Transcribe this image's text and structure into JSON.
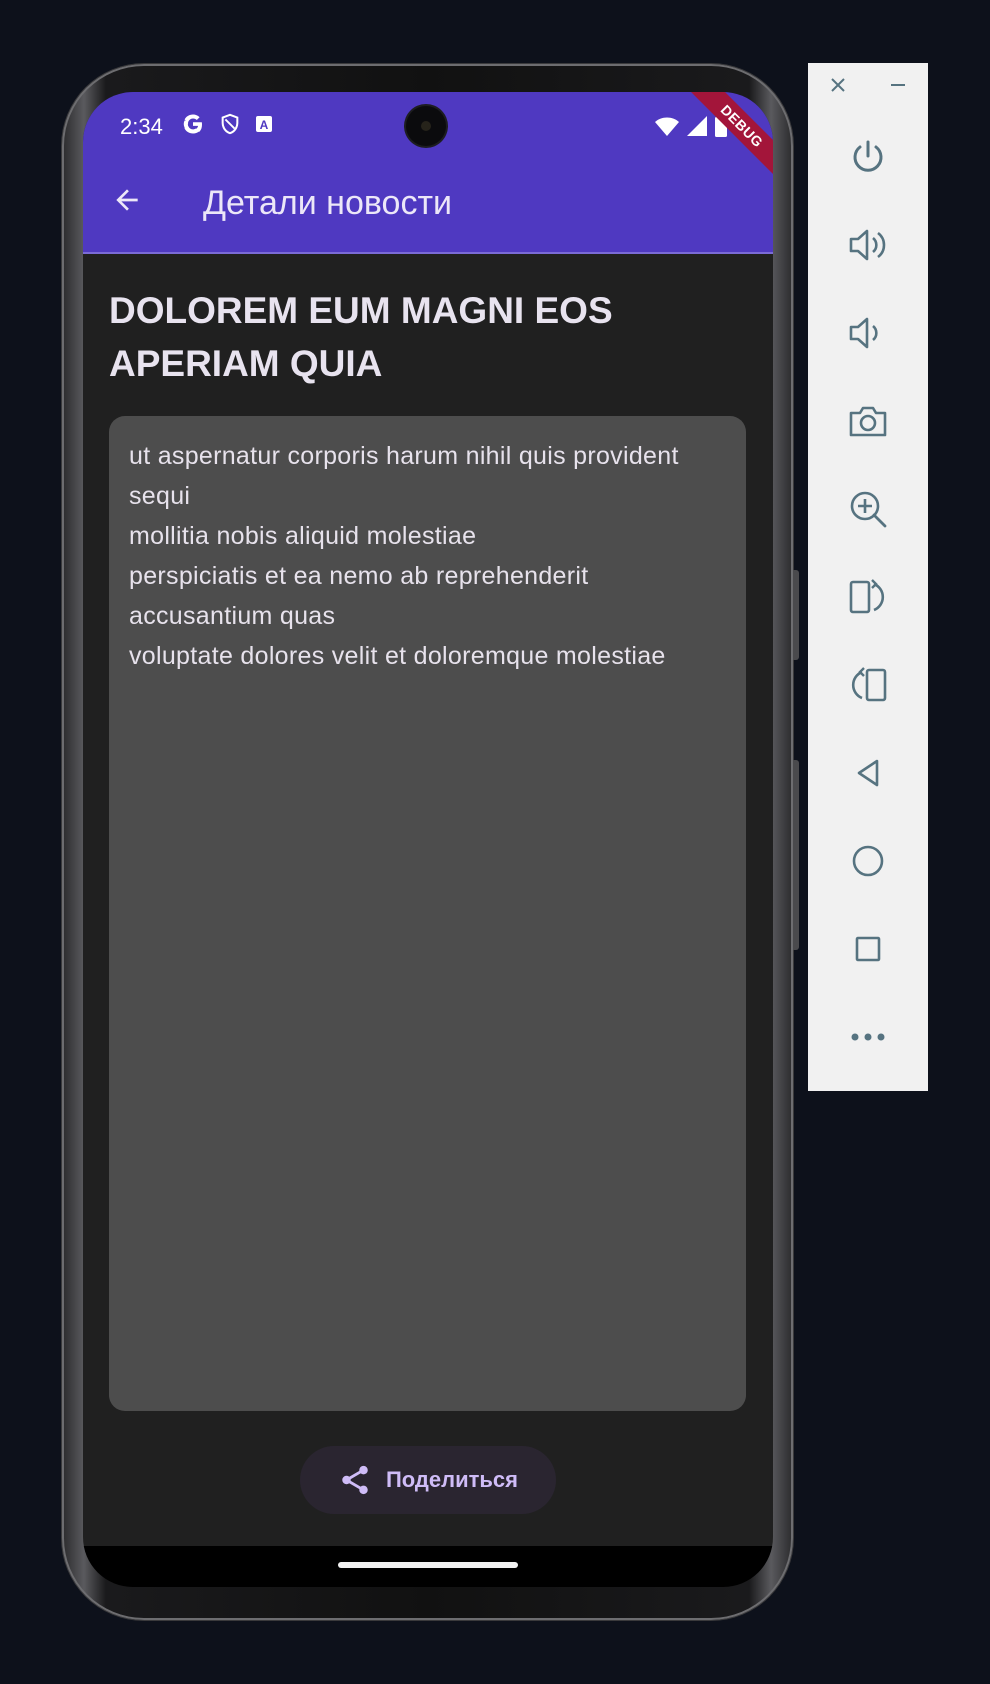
{
  "status_bar": {
    "time": "2:34",
    "icons_left": [
      "google-icon",
      "shield-icon",
      "font-icon"
    ],
    "icons_right": [
      "wifi-icon",
      "signal-icon",
      "battery-icon"
    ]
  },
  "debug_banner": "DEBUG",
  "app_bar": {
    "back_icon": "arrow-back-icon",
    "title": "Детали новости",
    "color": "#4f39c1"
  },
  "article": {
    "title": "DOLOREM EUM MAGNI EOS APERIAM QUIA",
    "body": "ut aspernatur corporis harum nihil quis provident sequi\nmollitia nobis aliquid molestiae\nperspiciatis et ea nemo ab reprehenderit accusantium quas\nvoluptate dolores velit et doloremque molestiae"
  },
  "share_button": {
    "icon": "share-icon",
    "label": "Поделиться",
    "accent": "#cfbcf7"
  },
  "emulator_toolbar": {
    "window_controls": [
      "close-icon",
      "minimize-icon"
    ],
    "buttons": [
      "power-icon",
      "volume-up-icon",
      "volume-down-icon",
      "camera-icon",
      "zoom-icon",
      "rotate-right-icon",
      "rotate-left-icon",
      "back-icon",
      "home-icon",
      "overview-icon",
      "more-icon"
    ]
  }
}
